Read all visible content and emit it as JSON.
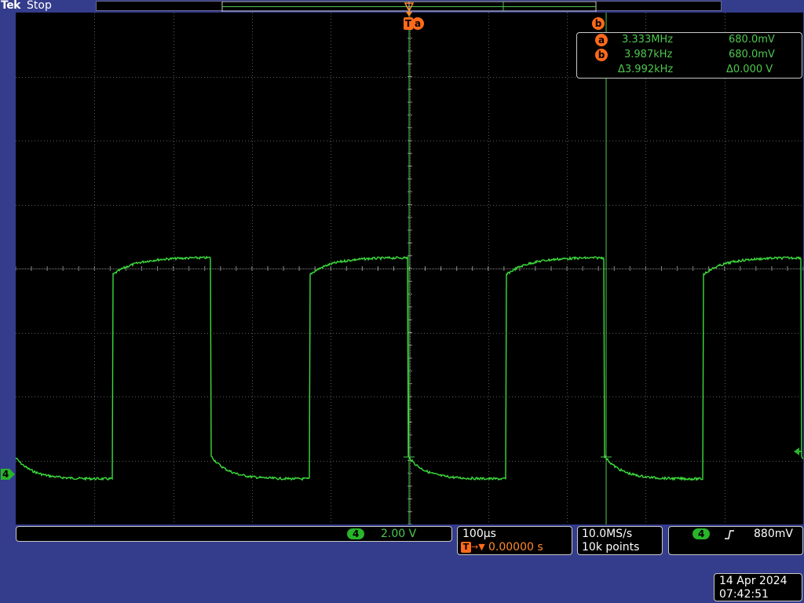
{
  "header": {
    "brand": "Tek",
    "status": "Stop"
  },
  "cursors": {
    "a_label": "a",
    "b_label": "b",
    "trigger_label": "T"
  },
  "readout": {
    "a": {
      "label": "a",
      "freq": "3.333MHz",
      "volt": "680.0mV"
    },
    "b": {
      "label": "b",
      "freq": "3.987kHz",
      "volt": "680.0mV"
    },
    "delta": {
      "freq": "Δ3.992kHz",
      "volt": "Δ0.000 V"
    }
  },
  "channel": {
    "number": "4",
    "scale": "2.00 V"
  },
  "timebase": {
    "scale": "100µs",
    "trigger_marker": "T",
    "arrow": "→▼",
    "position": "0.00000 s"
  },
  "acquisition": {
    "rate": "10.0MS/s",
    "points": "10k points"
  },
  "trigger": {
    "source": "4",
    "slope_icon": "rising-edge-icon",
    "level": "880mV"
  },
  "datetime": {
    "date": "14 Apr 2024",
    "time": "07:42:51"
  },
  "colors": {
    "background": "#343c8c",
    "trace": "#3cdc3c",
    "cursor": "#4ec84e",
    "accent": "#ff6a1a"
  }
}
